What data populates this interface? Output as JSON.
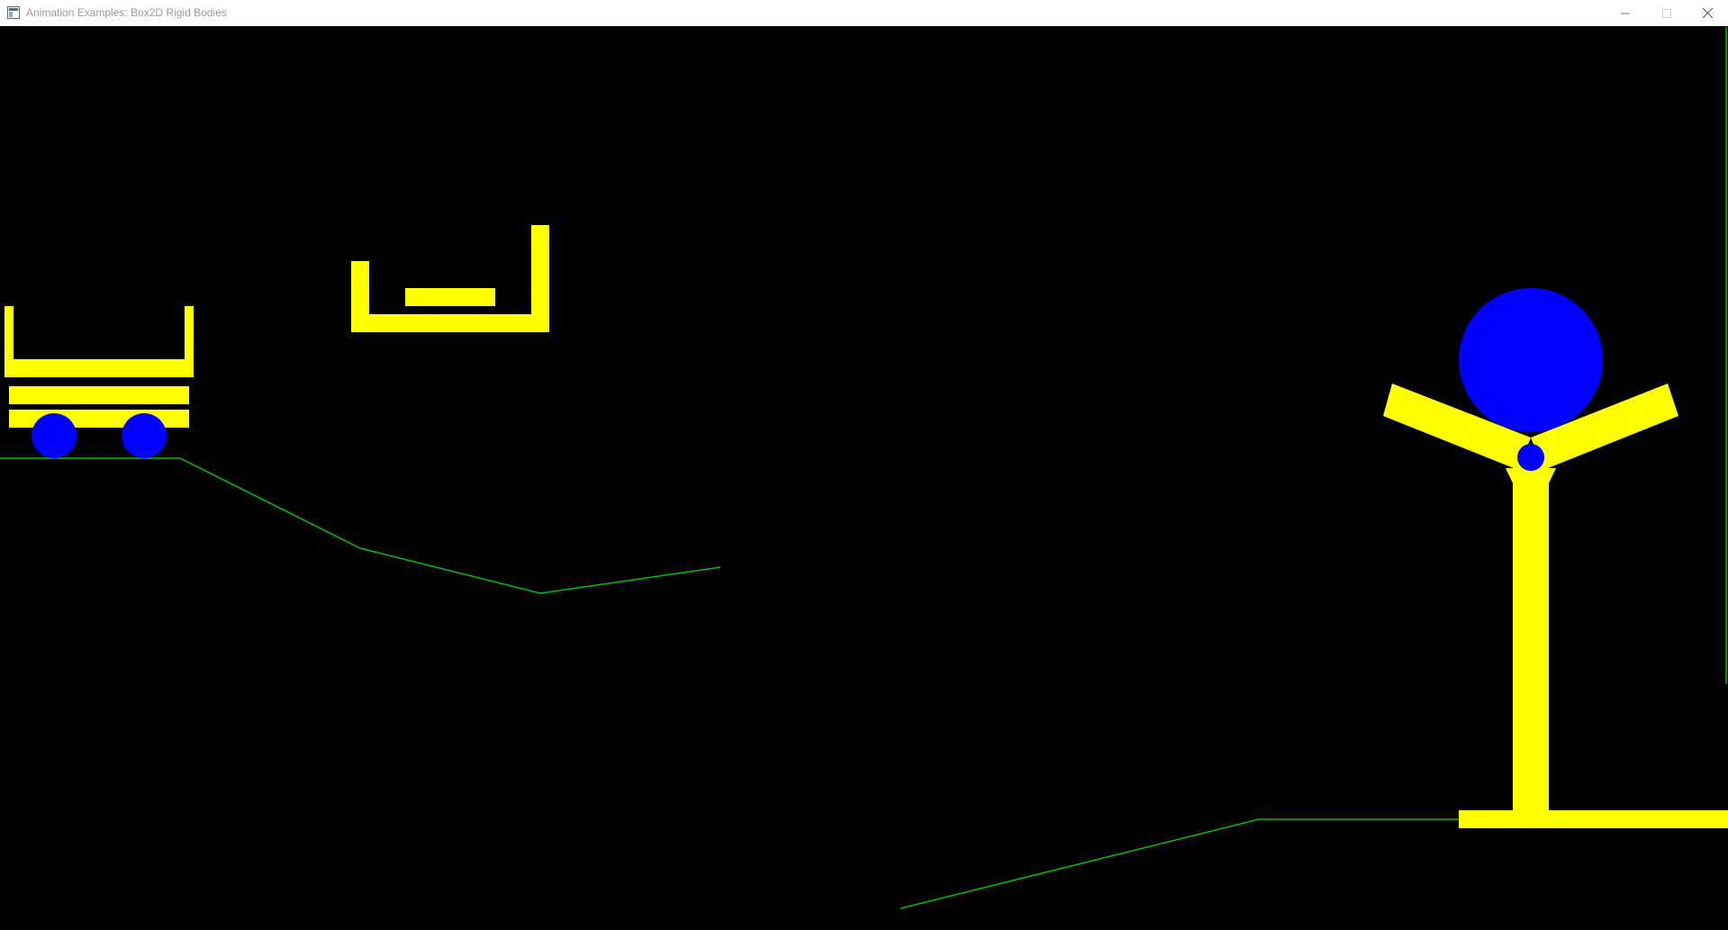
{
  "window": {
    "title": "Animation Examples: Box2D Rigid Bodies",
    "controls": {
      "minimize_icon": "minimize-icon",
      "maximize_icon": "maximize-icon",
      "close_icon": "close-icon"
    }
  },
  "colors": {
    "background": "#000000",
    "body": "#ffff00",
    "ball": "#0000ff",
    "terrain": "#00c000",
    "titlebar": "#ffffff",
    "title_text": "#9a9a9a"
  }
}
